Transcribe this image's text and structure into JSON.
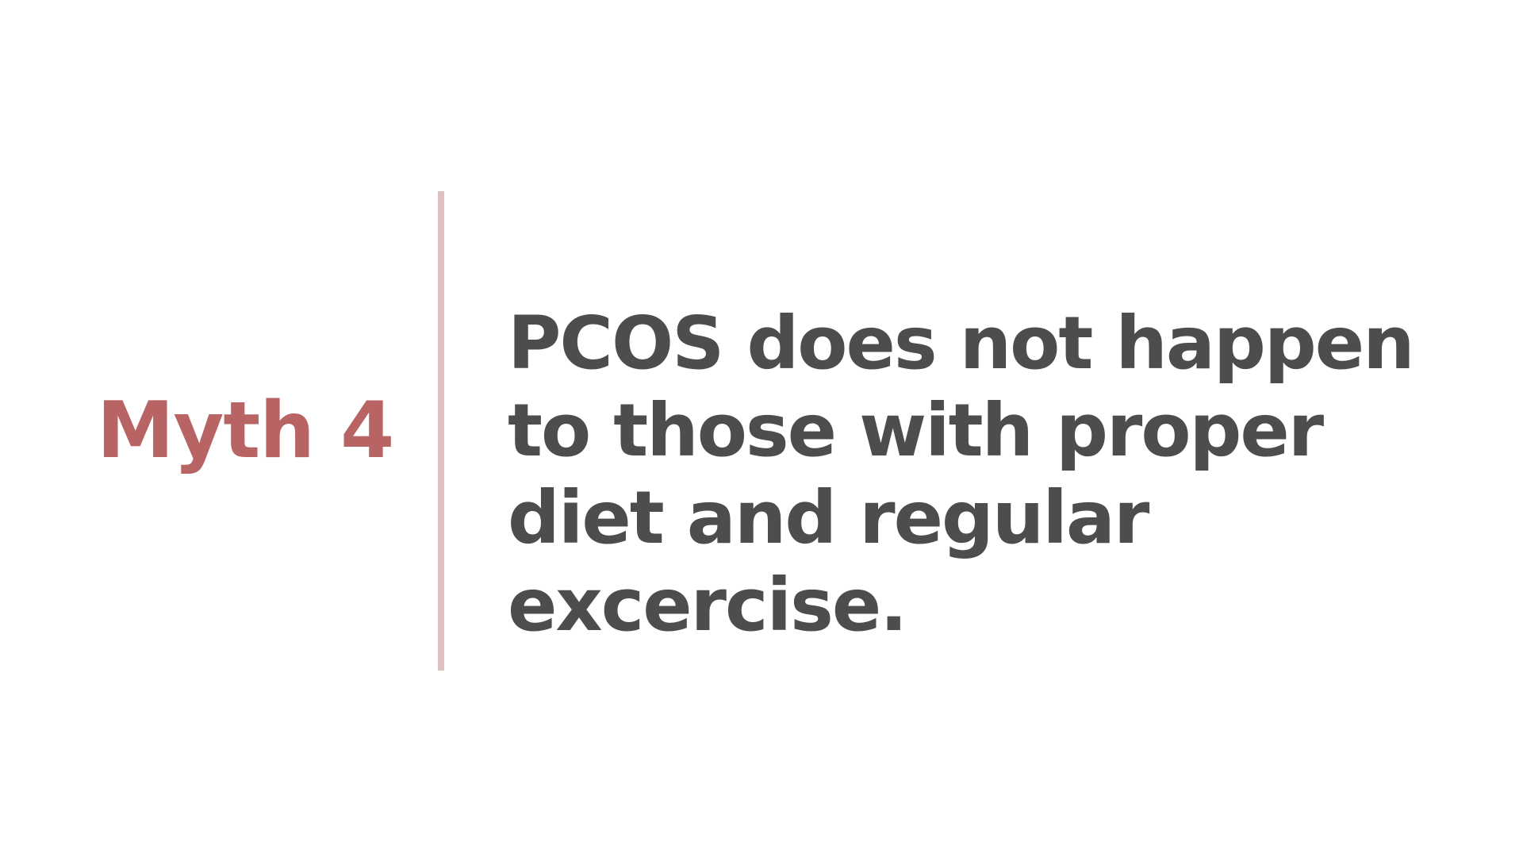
{
  "slide": {
    "myth_label": "Myth 4",
    "statement": "PCOS does not happen to those with proper diet and regular excercise."
  },
  "colors": {
    "background": "#ffffff",
    "accent": "#b86464",
    "divider": "#e0c0c2",
    "text": "#4d4d4d"
  }
}
